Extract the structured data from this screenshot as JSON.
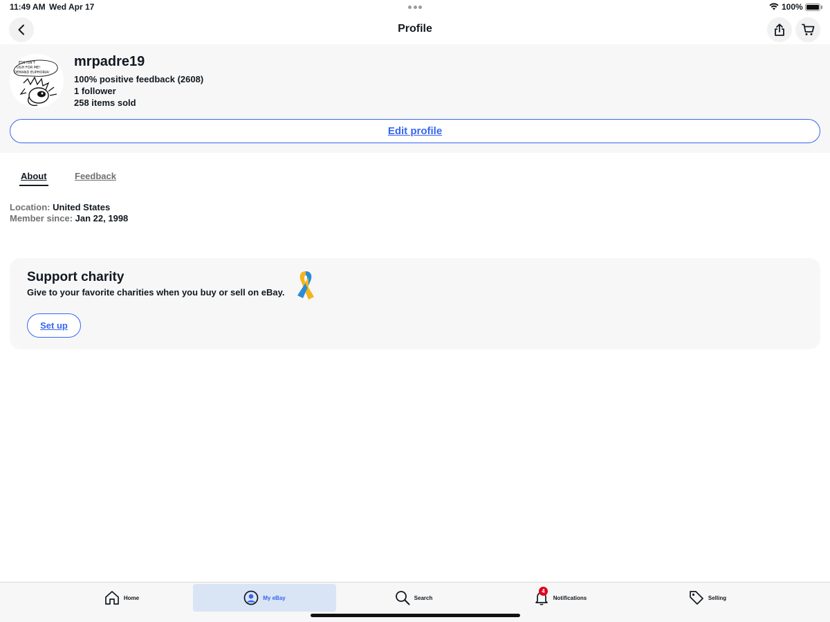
{
  "status_bar": {
    "time": "11:49 AM",
    "date": "Wed Apr 17",
    "battery_text": "100%",
    "battery_level": 1.0
  },
  "nav": {
    "title": "Profile",
    "icons": {
      "back": "chevron-left-icon",
      "share": "share-icon",
      "cart": "cart-icon"
    }
  },
  "profile": {
    "avatar_image_text": "HAPPINESS ISN'T ENOUGH FOR ME! I DEMAND EUPHORIA!",
    "username": "mrpadre19",
    "feedback": "100% positive feedback (2608)",
    "followers": "1 follower",
    "items_sold": "258 items sold",
    "edit_label": "Edit profile"
  },
  "tabs": {
    "about": "About",
    "feedback": "Feedback",
    "active": "About"
  },
  "about": {
    "location_label": "Location:",
    "location_value": "United States",
    "member_label": "Member since:",
    "member_value": "Jan 22, 1998"
  },
  "charity": {
    "title": "Support charity",
    "description": "Give to your favorite charities when you buy or sell on eBay.",
    "setup_label": "Set up",
    "ribbon_icon": "awareness-ribbon-icon"
  },
  "tabbar": {
    "items": [
      {
        "label": "Home",
        "icon": "home-icon"
      },
      {
        "label": "My eBay",
        "icon": "user-circle-icon"
      },
      {
        "label": "Search",
        "icon": "search-icon"
      },
      {
        "label": "Notifications",
        "icon": "bell-icon",
        "badge": "4"
      },
      {
        "label": "Selling",
        "icon": "tag-icon"
      }
    ],
    "active": "My eBay"
  },
  "colors": {
    "accent": "#3665f3",
    "text": "#111820",
    "muted": "#707070",
    "panel": "#f7f7f7",
    "badge": "#e0001b",
    "active_tab_bg": "#d9e4f5",
    "ribbon_blue": "#2a8bd6",
    "ribbon_yellow": "#f2b51b"
  }
}
